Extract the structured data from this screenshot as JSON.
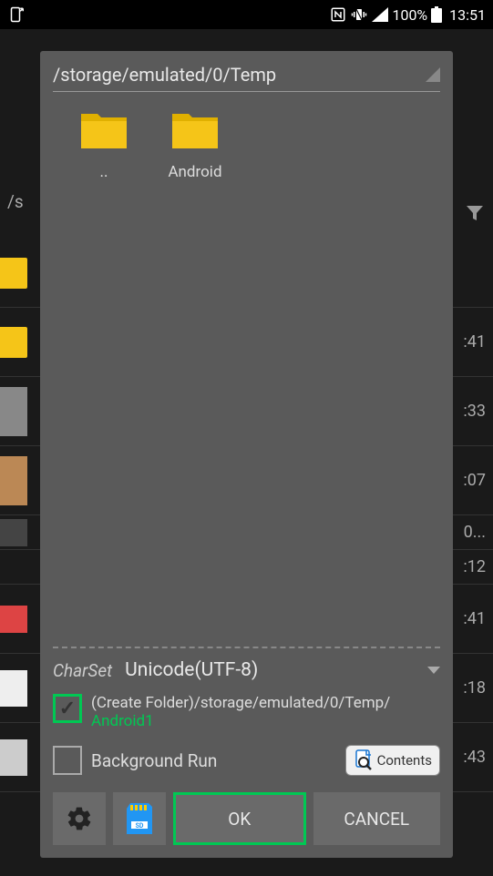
{
  "statusBar": {
    "battery": "100%",
    "time": "13:51"
  },
  "background": {
    "pathPrefix": "/s",
    "times": [
      ":41",
      ":33",
      ":07",
      "0...",
      ":12",
      ":41",
      ":18",
      ":43"
    ]
  },
  "dialog": {
    "path": "/storage/emulated/0/Temp",
    "folders": [
      {
        "label": ".."
      },
      {
        "label": "Android"
      }
    ],
    "charset": {
      "label": "CharSet",
      "value": "Unicode(UTF-8)"
    },
    "createFolder": {
      "checked": true,
      "text": "(Create Folder)/storage/emulated/0/Temp/",
      "folderName": "Android1"
    },
    "backgroundRun": {
      "checked": false,
      "label": "Background Run"
    },
    "contentsBtn": "Contents",
    "buttons": {
      "ok": "OK",
      "cancel": "CANCEL"
    }
  }
}
